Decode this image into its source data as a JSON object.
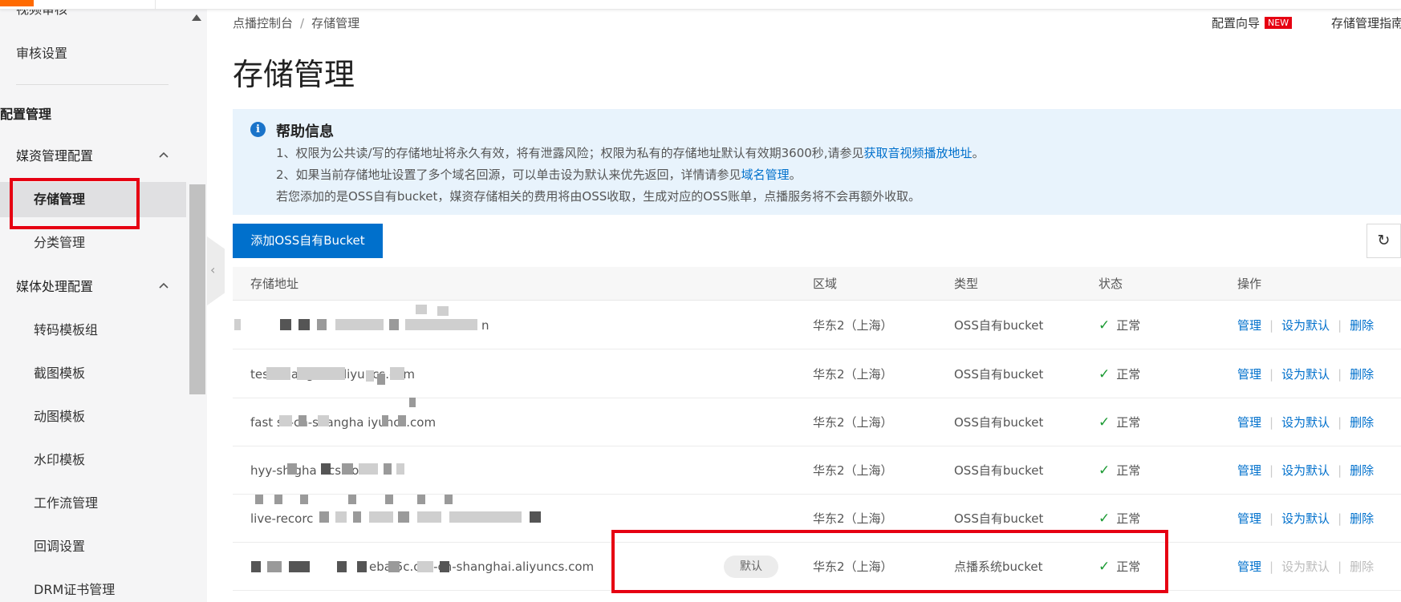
{
  "sidebar": {
    "cut_item": "视频审核",
    "audit_settings": "审核设置",
    "section": "配置管理",
    "group_media_assets": "媒资管理配置",
    "storage": "存储管理",
    "category": "分类管理",
    "group_media_processing": "媒体处理配置",
    "transcode": "转码模板组",
    "snapshot": "截图模板",
    "gif": "动图模板",
    "watermark": "水印模板",
    "workflow": "工作流管理",
    "callback": "回调设置",
    "drm": "DRM证书管理"
  },
  "breadcrumb": {
    "root": "点播控制台",
    "separator": "/",
    "current": "存储管理"
  },
  "header": {
    "wizard": "配置向导",
    "new_badge": "NEW",
    "guide": "存储管理指南"
  },
  "page_title": "存储管理",
  "help": {
    "title": "帮助信息",
    "line1_prefix": "1、权限为公共读/写的存储地址将永久有效，将有泄露风险；权限为私有的存储地址默认有效期3600秒,请参见",
    "line1_link": "获取音视频播放地址",
    "line1_suffix": "。",
    "line2_prefix": "2、如果当前存储地址设置了多个域名回源，可以单击设为默认来优先返回，详情请参见",
    "line2_link": "域名管理",
    "line2_suffix": "。",
    "line3": "若您添加的是OSS自有bucket，媒资存储相关的费用将由OSS收取，生成对应的OSS账单，点播服务将不会再额外收取。"
  },
  "add_button": "添加OSS自有Bucket",
  "refresh_icon": "refresh-icon",
  "table": {
    "headers": {
      "address": "存储地址",
      "region": "区域",
      "type": "类型",
      "status": "状态",
      "actions": "操作"
    },
    "rows": [
      {
        "address": "n",
        "region": "华东2（上海）",
        "type": "OSS自有bucket",
        "status": "正常",
        "manage": "管理",
        "set_default": "设为默认",
        "delete": "删除"
      },
      {
        "address": "test            shanghai aliyuncs.com",
        "region": "华东2（上海）",
        "type": "OSS自有bucket",
        "status": "正常",
        "manage": "管理",
        "set_default": "设为默认",
        "delete": "删除"
      },
      {
        "address": "fast      ss-cn-shangha   iyuncs.com",
        "region": "华东2（上海）",
        "type": "OSS自有bucket",
        "status": "正常",
        "manage": "管理",
        "set_default": "设为默认",
        "delete": "删除"
      },
      {
        "address": "hyy-sh             gha    ncs.com",
        "region": "华东2（上海）",
        "type": "OSS自有bucket",
        "status": "正常",
        "manage": "管理",
        "set_default": "设为默认",
        "delete": "删除"
      },
      {
        "address": "live-recorc",
        "region": "华东2（上海）",
        "type": "OSS自有bucket",
        "status": "正常",
        "manage": "管理",
        "set_default": "设为默认",
        "delete": "删除"
      },
      {
        "address": "eba          5c.oss-cn-shanghai.aliyuncs.com",
        "default_tag": "默认",
        "region": "华东2（上海）",
        "type": "点播系统bucket",
        "status": "正常",
        "manage": "管理",
        "set_default": "设为默认",
        "delete": "删除"
      }
    ]
  },
  "colors": {
    "primary": "#0070cc",
    "annotation_red": "#e60012",
    "ok_green": "#1b9a33",
    "brand_orange": "#ff6a00"
  }
}
